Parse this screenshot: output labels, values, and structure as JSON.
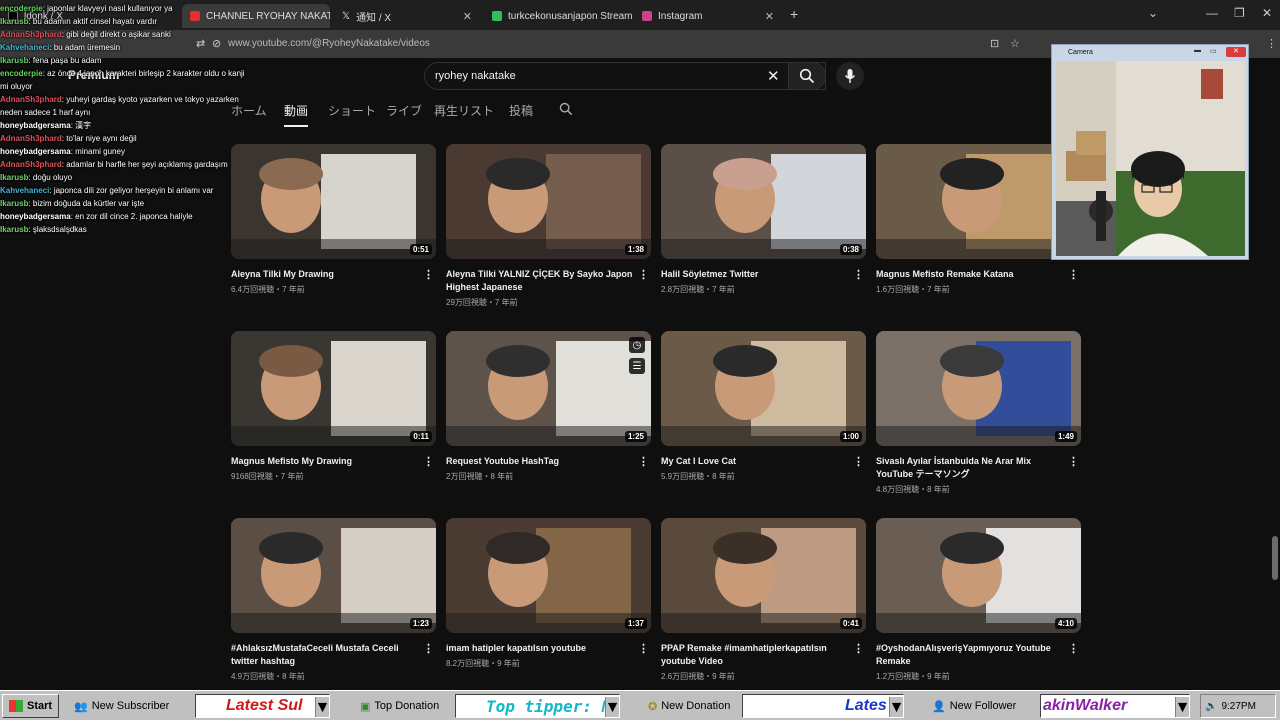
{
  "browser": {
    "tabs": [
      {
        "label": "ldonk / X"
      },
      {
        "label": "CHANNEL RYOHAY NAKATAKE"
      },
      {
        "label": "通知 / X"
      },
      {
        "label": "turkcekonusanjapon Stream - V"
      },
      {
        "label": "Instagram"
      }
    ],
    "url": "www.youtube.com/@RyoheyNakatake/videos"
  },
  "youtube": {
    "premium_label": "Premium",
    "search_value": "ryohey nakatake",
    "channel_tabs": [
      "ホーム",
      "動画",
      "ショート",
      "ライブ",
      "再生リスト",
      "投稿"
    ],
    "active_tab": "動画"
  },
  "videos": [
    {
      "title": "Aleyna Tilki My Drawing",
      "meta": "6.4万回視聴・7 年前",
      "duration": "0:51"
    },
    {
      "title": "Aleyna Tilki YALNIZ ÇİÇEK By Sayko Japon Highest Japanese",
      "meta": "29万回視聴・7 年前",
      "duration": "1:38"
    },
    {
      "title": "Halil Söyletmez Twitter",
      "meta": "2.8万回視聴・7 年前",
      "duration": "0:38"
    },
    {
      "title": "Magnus Mefisto Remake Katana",
      "meta": "1.6万回視聴・7 年前",
      "duration": ""
    },
    {
      "title": "Magnus Mefisto My Drawing",
      "meta": "9168回視聴・7 年前",
      "duration": "0:11"
    },
    {
      "title": "Request Youtube HashTag",
      "meta": "2万回視聴・8 年前",
      "duration": "1:25"
    },
    {
      "title": "My Cat I Love Cat",
      "meta": "5.9万回視聴・8 年前",
      "duration": "1:00"
    },
    {
      "title": "Sivaslı Ayılar İstanbulda Ne Arar Mix YouTube テーマソング",
      "meta": "4.8万回視聴・8 年前",
      "duration": "1:49"
    },
    {
      "title": "#AhlaksızMustafaCeceli Mustafa Ceceli twitter hashtag",
      "meta": "4.9万回視聴・8 年前",
      "duration": "1:23"
    },
    {
      "title": "imam hatipler kapatılsın youtube",
      "meta": "8.2万回視聴・9 年前",
      "duration": "1:37"
    },
    {
      "title": "PPAP Remake #imamhatiplerkapatılsın youtube Video",
      "meta": "2.6万回視聴・9 年前",
      "duration": "0:41"
    },
    {
      "title": "#OyshodanAlışverişYapmıyoruz Youtube Remake",
      "meta": "1.2万回視聴・9 年前",
      "duration": "4:10"
    }
  ],
  "chat": [
    {
      "user": "encoderpie",
      "text": "japonlar klavyeyi nasıl kullanıyor ya",
      "color": "#5fd45f"
    },
    {
      "user": "Ikarusb",
      "text": "bu adamın aktif cinsel hayatı vardır",
      "color": "#6fd46f"
    },
    {
      "user": "AdnanSh3phard",
      "text": "gibi değil direkt o aşikar sanki",
      "color": "#e0505a"
    },
    {
      "user": "Kahvehaneci",
      "text": "bu adam üremesin",
      "color": "#3fb5d9"
    },
    {
      "user": "Ikarusb",
      "text": "fena paşa bu adam",
      "color": "#6fd46f"
    },
    {
      "user": "encoderpie",
      "text": "az önce 4 japon karakteri birleşip 2 karakter oldu o kanji mi oluyor",
      "color": "#5fd45f"
    },
    {
      "user": "AdnanSh3phard",
      "text": "yuheyi gardaş kyoto yazarken ve tokyo yazarken neden sadece 1 harf aynı",
      "color": "#e0505a"
    },
    {
      "user": "honeybadgersama",
      "text": "漢字",
      "color": "#ffffff"
    },
    {
      "user": "AdnanSh3phard",
      "text": "to'lar niye aynı değil",
      "color": "#e0505a"
    },
    {
      "user": "honeybadgersama",
      "text": "minami guney",
      "color": "#ffffff"
    },
    {
      "user": "AdnanSh3phard",
      "text": "adamlar bi harfle her şeyi açıklamış gardaşım",
      "color": "#e0505a"
    },
    {
      "user": "Ikarusb",
      "text": "doğu oluyo",
      "color": "#6fd46f"
    },
    {
      "user": "Kahvehaneci",
      "text": "japonca dili zor geliyor herşeyin bi anlamı var",
      "color": "#3fb5d9"
    },
    {
      "user": "Ikarusb",
      "text": "bizim doğuda da kürtler var işte",
      "color": "#6fd46f"
    },
    {
      "user": "honeybadgersama",
      "text": "en zor dil cince 2. japonca haliyle",
      "color": "#ffffff"
    },
    {
      "user": "Ikarusb",
      "text": "şlaksdsalşdkas",
      "color": "#6fd46f"
    }
  ],
  "camera": {
    "title": "Camera"
  },
  "taskbar": {
    "start": "Start",
    "new_subscriber": "New Subscriber",
    "latest_sub_ticker": "Latest Sul",
    "top_donation": "Top Donation",
    "top_tipper_ticker": "Top tipper: N",
    "new_donation": "New Donation",
    "latest_ticker": "Lates",
    "new_follower": "New Follower",
    "follower_ticker": "akinWalker",
    "clock": "9:27PM"
  }
}
